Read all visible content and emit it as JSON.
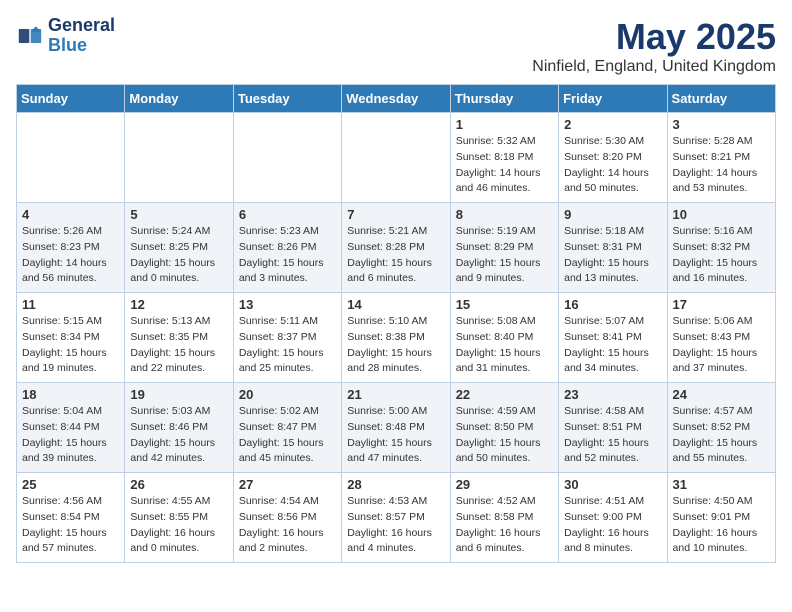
{
  "logo": {
    "line1": "General",
    "line2": "Blue"
  },
  "title": "May 2025",
  "subtitle": "Ninfield, England, United Kingdom",
  "days_of_week": [
    "Sunday",
    "Monday",
    "Tuesday",
    "Wednesday",
    "Thursday",
    "Friday",
    "Saturday"
  ],
  "weeks": [
    [
      {
        "day": "",
        "info": ""
      },
      {
        "day": "",
        "info": ""
      },
      {
        "day": "",
        "info": ""
      },
      {
        "day": "",
        "info": ""
      },
      {
        "day": "1",
        "info": "Sunrise: 5:32 AM\nSunset: 8:18 PM\nDaylight: 14 hours\nand 46 minutes."
      },
      {
        "day": "2",
        "info": "Sunrise: 5:30 AM\nSunset: 8:20 PM\nDaylight: 14 hours\nand 50 minutes."
      },
      {
        "day": "3",
        "info": "Sunrise: 5:28 AM\nSunset: 8:21 PM\nDaylight: 14 hours\nand 53 minutes."
      }
    ],
    [
      {
        "day": "4",
        "info": "Sunrise: 5:26 AM\nSunset: 8:23 PM\nDaylight: 14 hours\nand 56 minutes."
      },
      {
        "day": "5",
        "info": "Sunrise: 5:24 AM\nSunset: 8:25 PM\nDaylight: 15 hours\nand 0 minutes."
      },
      {
        "day": "6",
        "info": "Sunrise: 5:23 AM\nSunset: 8:26 PM\nDaylight: 15 hours\nand 3 minutes."
      },
      {
        "day": "7",
        "info": "Sunrise: 5:21 AM\nSunset: 8:28 PM\nDaylight: 15 hours\nand 6 minutes."
      },
      {
        "day": "8",
        "info": "Sunrise: 5:19 AM\nSunset: 8:29 PM\nDaylight: 15 hours\nand 9 minutes."
      },
      {
        "day": "9",
        "info": "Sunrise: 5:18 AM\nSunset: 8:31 PM\nDaylight: 15 hours\nand 13 minutes."
      },
      {
        "day": "10",
        "info": "Sunrise: 5:16 AM\nSunset: 8:32 PM\nDaylight: 15 hours\nand 16 minutes."
      }
    ],
    [
      {
        "day": "11",
        "info": "Sunrise: 5:15 AM\nSunset: 8:34 PM\nDaylight: 15 hours\nand 19 minutes."
      },
      {
        "day": "12",
        "info": "Sunrise: 5:13 AM\nSunset: 8:35 PM\nDaylight: 15 hours\nand 22 minutes."
      },
      {
        "day": "13",
        "info": "Sunrise: 5:11 AM\nSunset: 8:37 PM\nDaylight: 15 hours\nand 25 minutes."
      },
      {
        "day": "14",
        "info": "Sunrise: 5:10 AM\nSunset: 8:38 PM\nDaylight: 15 hours\nand 28 minutes."
      },
      {
        "day": "15",
        "info": "Sunrise: 5:08 AM\nSunset: 8:40 PM\nDaylight: 15 hours\nand 31 minutes."
      },
      {
        "day": "16",
        "info": "Sunrise: 5:07 AM\nSunset: 8:41 PM\nDaylight: 15 hours\nand 34 minutes."
      },
      {
        "day": "17",
        "info": "Sunrise: 5:06 AM\nSunset: 8:43 PM\nDaylight: 15 hours\nand 37 minutes."
      }
    ],
    [
      {
        "day": "18",
        "info": "Sunrise: 5:04 AM\nSunset: 8:44 PM\nDaylight: 15 hours\nand 39 minutes."
      },
      {
        "day": "19",
        "info": "Sunrise: 5:03 AM\nSunset: 8:46 PM\nDaylight: 15 hours\nand 42 minutes."
      },
      {
        "day": "20",
        "info": "Sunrise: 5:02 AM\nSunset: 8:47 PM\nDaylight: 15 hours\nand 45 minutes."
      },
      {
        "day": "21",
        "info": "Sunrise: 5:00 AM\nSunset: 8:48 PM\nDaylight: 15 hours\nand 47 minutes."
      },
      {
        "day": "22",
        "info": "Sunrise: 4:59 AM\nSunset: 8:50 PM\nDaylight: 15 hours\nand 50 minutes."
      },
      {
        "day": "23",
        "info": "Sunrise: 4:58 AM\nSunset: 8:51 PM\nDaylight: 15 hours\nand 52 minutes."
      },
      {
        "day": "24",
        "info": "Sunrise: 4:57 AM\nSunset: 8:52 PM\nDaylight: 15 hours\nand 55 minutes."
      }
    ],
    [
      {
        "day": "25",
        "info": "Sunrise: 4:56 AM\nSunset: 8:54 PM\nDaylight: 15 hours\nand 57 minutes."
      },
      {
        "day": "26",
        "info": "Sunrise: 4:55 AM\nSunset: 8:55 PM\nDaylight: 16 hours\nand 0 minutes."
      },
      {
        "day": "27",
        "info": "Sunrise: 4:54 AM\nSunset: 8:56 PM\nDaylight: 16 hours\nand 2 minutes."
      },
      {
        "day": "28",
        "info": "Sunrise: 4:53 AM\nSunset: 8:57 PM\nDaylight: 16 hours\nand 4 minutes."
      },
      {
        "day": "29",
        "info": "Sunrise: 4:52 AM\nSunset: 8:58 PM\nDaylight: 16 hours\nand 6 minutes."
      },
      {
        "day": "30",
        "info": "Sunrise: 4:51 AM\nSunset: 9:00 PM\nDaylight: 16 hours\nand 8 minutes."
      },
      {
        "day": "31",
        "info": "Sunrise: 4:50 AM\nSunset: 9:01 PM\nDaylight: 16 hours\nand 10 minutes."
      }
    ]
  ]
}
